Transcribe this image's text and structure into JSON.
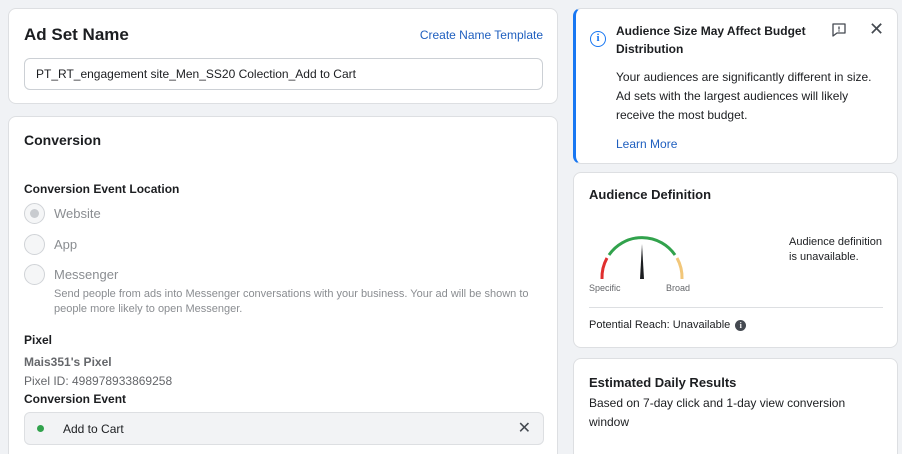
{
  "ad_set": {
    "title": "Ad Set Name",
    "create_template_link": "Create Name Template",
    "name_value": "PT_RT_engagement site_Men_SS20 Colection_Add to Cart"
  },
  "conversion": {
    "title": "Conversion",
    "location_label": "Conversion Event Location",
    "options": [
      {
        "label": "Website",
        "selected": true
      },
      {
        "label": "App",
        "selected": false
      },
      {
        "label": "Messenger",
        "selected": false
      }
    ],
    "messenger_help": "Send people from ads into Messenger conversations with your business. Your ad will be shown to people more likely to open Messenger.",
    "pixel_label": "Pixel",
    "pixel_name": "Mais351's Pixel",
    "pixel_id": "Pixel ID: 498978933869258",
    "event_label": "Conversion Event",
    "event_value": "Add to Cart",
    "event_status_color": "#31a24c"
  },
  "alert": {
    "title": "Audience Size May Affect Budget Distribution",
    "body": "Your audiences are significantly different in size. Ad sets with the largest audiences will likely receive the most budget.",
    "link": "Learn More",
    "accent_color": "#1877f2"
  },
  "audience": {
    "title": "Audience Definition",
    "gauge_specific": "Specific",
    "gauge_broad": "Broad",
    "note": "Audience definition is unavailable.",
    "reach": "Potential Reach: Unavailable"
  },
  "estimate": {
    "title": "Estimated Daily Results",
    "body": "Based on 7-day click and 1-day view conversion window"
  }
}
